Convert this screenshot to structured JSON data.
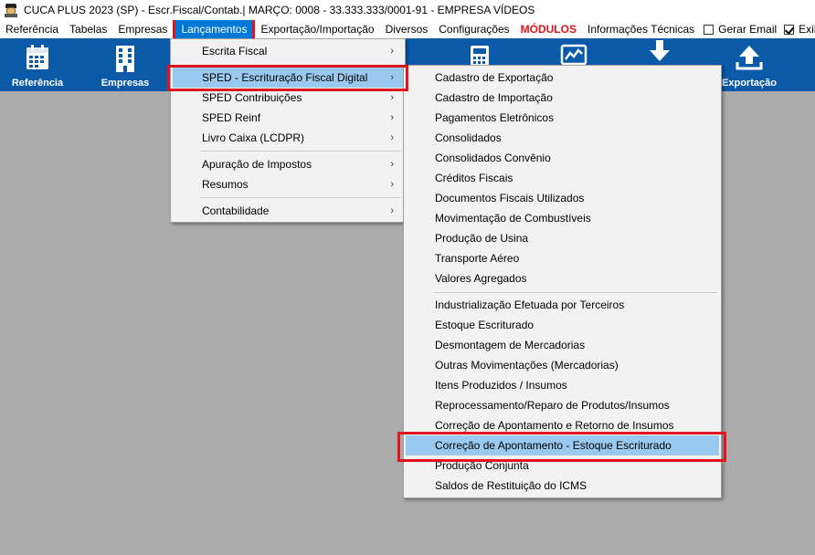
{
  "window": {
    "title": "CUCA PLUS 2023 (SP) - Escr.Fiscal/Contab.| MARÇO: 0008 - 33.333.333/0001-91 - EMPRESA VÍDEOS"
  },
  "menubar": {
    "items": [
      {
        "label": "Referência"
      },
      {
        "label": "Tabelas"
      },
      {
        "label": "Empresas"
      },
      {
        "label": "Lançamentos"
      },
      {
        "label": "Exportação/Importação"
      },
      {
        "label": "Diversos"
      },
      {
        "label": "Configurações"
      },
      {
        "label": "MÓDULOS"
      },
      {
        "label": "Informações Técnicas"
      }
    ],
    "gerar_email": {
      "label": "Gerar Email",
      "checked": false
    },
    "exibir": {
      "label": "Exibir B",
      "checked": true
    }
  },
  "toolbar": {
    "buttons": [
      {
        "label": "Referência",
        "icon": "calendar-icon"
      },
      {
        "label": "Empresas",
        "icon": "building-icon"
      },
      {
        "label": "",
        "icon": "calculator-icon"
      },
      {
        "label": "",
        "icon": "chart-icon"
      },
      {
        "label": "",
        "icon": "download-icon"
      },
      {
        "label": "Exportação",
        "icon": "upload-icon"
      }
    ]
  },
  "lancamentos_menu": {
    "items": [
      {
        "label": "Escrita Fiscal",
        "arrow": "›"
      },
      {
        "label": "SPED - Escrituração Fiscal Digital",
        "arrow": "›"
      },
      {
        "label": "SPED Contribuições",
        "arrow": "›"
      },
      {
        "label": "SPED Reinf",
        "arrow": "›"
      },
      {
        "label": "Livro Caixa (LCDPR)",
        "arrow": "›"
      },
      {
        "label": "Apuração de Impostos",
        "arrow": "›"
      },
      {
        "label": "Resumos",
        "arrow": "›"
      },
      {
        "label": "Contabilidade",
        "arrow": "›"
      }
    ]
  },
  "sped_submenu": {
    "items": [
      {
        "label": "Cadastro de Exportação"
      },
      {
        "label": "Cadastro de Importação"
      },
      {
        "label": "Pagamentos Eletrônicos"
      },
      {
        "label": "Consolidados"
      },
      {
        "label": "Consolidados Convênio"
      },
      {
        "label": "Créditos Fiscais"
      },
      {
        "label": "Documentos Fiscais Utilizados"
      },
      {
        "label": "Movimentação de Combustíveis"
      },
      {
        "label": "Produção de Usina"
      },
      {
        "label": "Transporte Aéreo"
      },
      {
        "label": "Valores Agregados"
      },
      {
        "label": "Industrialização Efetuada por Terceiros"
      },
      {
        "label": "Estoque Escriturado"
      },
      {
        "label": "Desmontagem de Mercadorias"
      },
      {
        "label": "Outras Movimentações (Mercadorias)"
      },
      {
        "label": "Itens Produzidos / Insumos"
      },
      {
        "label": "Reprocessamento/Reparo de Produtos/Insumos"
      },
      {
        "label": "Correção de Apontamento e Retorno de Insumos"
      },
      {
        "label": "Correção de Apontamento - Estoque Escriturado"
      },
      {
        "label": "Produção Conjunta"
      },
      {
        "label": "Saldos de Restituição do ICMS"
      }
    ]
  },
  "colors": {
    "toolbar_bg": "#0b5aa8",
    "highlight": "#99c9ef",
    "annotation_red": "#e0141e",
    "modulos": "#e0141e"
  }
}
